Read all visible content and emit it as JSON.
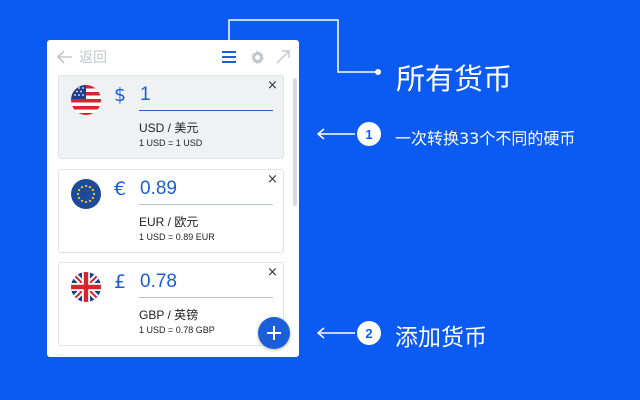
{
  "toolbar": {
    "back_label": "返回",
    "icons": [
      "arrow-left-icon",
      "list-icon",
      "gear-icon",
      "expand-icon"
    ]
  },
  "currencies": [
    {
      "flag": "us-flag-icon",
      "symbol": "$",
      "amount": "1",
      "name": "USD / 美元",
      "rate": "1 USD = 1 USD",
      "close": "×",
      "active": true
    },
    {
      "flag": "eu-flag-icon",
      "symbol": "€",
      "amount": "0.89",
      "name": "EUR / 欧元",
      "rate": "1 USD = 0.89 EUR",
      "close": "×",
      "active": false
    },
    {
      "flag": "uk-flag-icon",
      "symbol": "£",
      "amount": "0.78",
      "name": "GBP / 英镑",
      "rate": "1 USD = 0.78 GBP",
      "close": "×",
      "active": false
    }
  ],
  "add_button": {
    "icon": "plus-icon"
  },
  "callouts": {
    "main": "所有货币",
    "item1": {
      "number": "1",
      "text": "一次转换33个不同的硬币"
    },
    "item2": {
      "number": "2",
      "text": "添加货币"
    }
  },
  "colors": {
    "background": "#0b5bf2",
    "accent": "#1a5ed8",
    "panel": "#ffffff"
  }
}
